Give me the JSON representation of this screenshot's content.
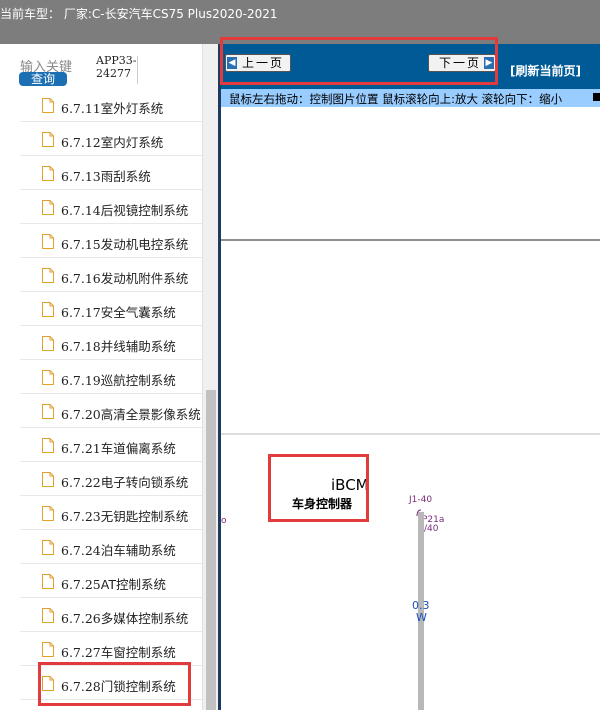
{
  "header": {
    "car_model": "当前车型：  厂家:C-长安汽车CS75 Plus2020-2021"
  },
  "sidebar": {
    "search": {
      "keyword_label": "输入关键",
      "query_button": "查询",
      "version_line1": "APP33-",
      "version_line2": "24277"
    },
    "items": [
      {
        "num": "6.7.11",
        "label": "室外灯系统"
      },
      {
        "num": "6.7.12",
        "label": "室内灯系统"
      },
      {
        "num": "6.7.13",
        "label": "雨刮系统"
      },
      {
        "num": "6.7.14",
        "label": "后视镜控制系统"
      },
      {
        "num": "6.7.15",
        "label": "发动机电控系统"
      },
      {
        "num": "6.7.16",
        "label": "发动机附件系统"
      },
      {
        "num": "6.7.17",
        "label": "安全气囊系统"
      },
      {
        "num": "6.7.18",
        "label": "并线辅助系统"
      },
      {
        "num": "6.7.19",
        "label": "巡航控制系统"
      },
      {
        "num": "6.7.20",
        "label": "高清全景影像系统"
      },
      {
        "num": "6.7.21",
        "label": "车道偏离系统"
      },
      {
        "num": "6.7.22",
        "label": "电子转向锁系统"
      },
      {
        "num": "6.7.23",
        "label": "无钥匙控制系统"
      },
      {
        "num": "6.7.24",
        "label": "泊车辅助系统"
      },
      {
        "num": "6.7.25",
        "label": "AT控制系统"
      },
      {
        "num": "6.7.26",
        "label": "多媒体控制系统"
      },
      {
        "num": "6.7.27",
        "label": "车窗控制系统"
      },
      {
        "num": "6.7.28",
        "label": "门锁控制系统"
      }
    ]
  },
  "viewer": {
    "prev_button": "上一页",
    "next_button": "下一页",
    "refresh_link": "[刷新当前页]",
    "hint": "鼠标左右拖动：控制图片位置 鼠标滚轮向上:放大  滚轮向下：缩小"
  },
  "diagram": {
    "module_name": "iBCM",
    "module_desc": "车身控制器",
    "connector": "J1-40",
    "pin_label": "P21a",
    "pin_sub": "/40",
    "wire_size": "0.3",
    "wire_color": "W",
    "colors": {
      "wire_purple": "#7b2d7b",
      "wire_text_blue": "#1a4fbf",
      "wire_gray": "#b8b8b8"
    }
  },
  "colors": {
    "topbar": "#7d7d7d",
    "nav_blue": "#005a96",
    "hint_blue": "#99ccff",
    "query_blue": "#1d6fb3",
    "highlight_red": "#e23b3b"
  }
}
